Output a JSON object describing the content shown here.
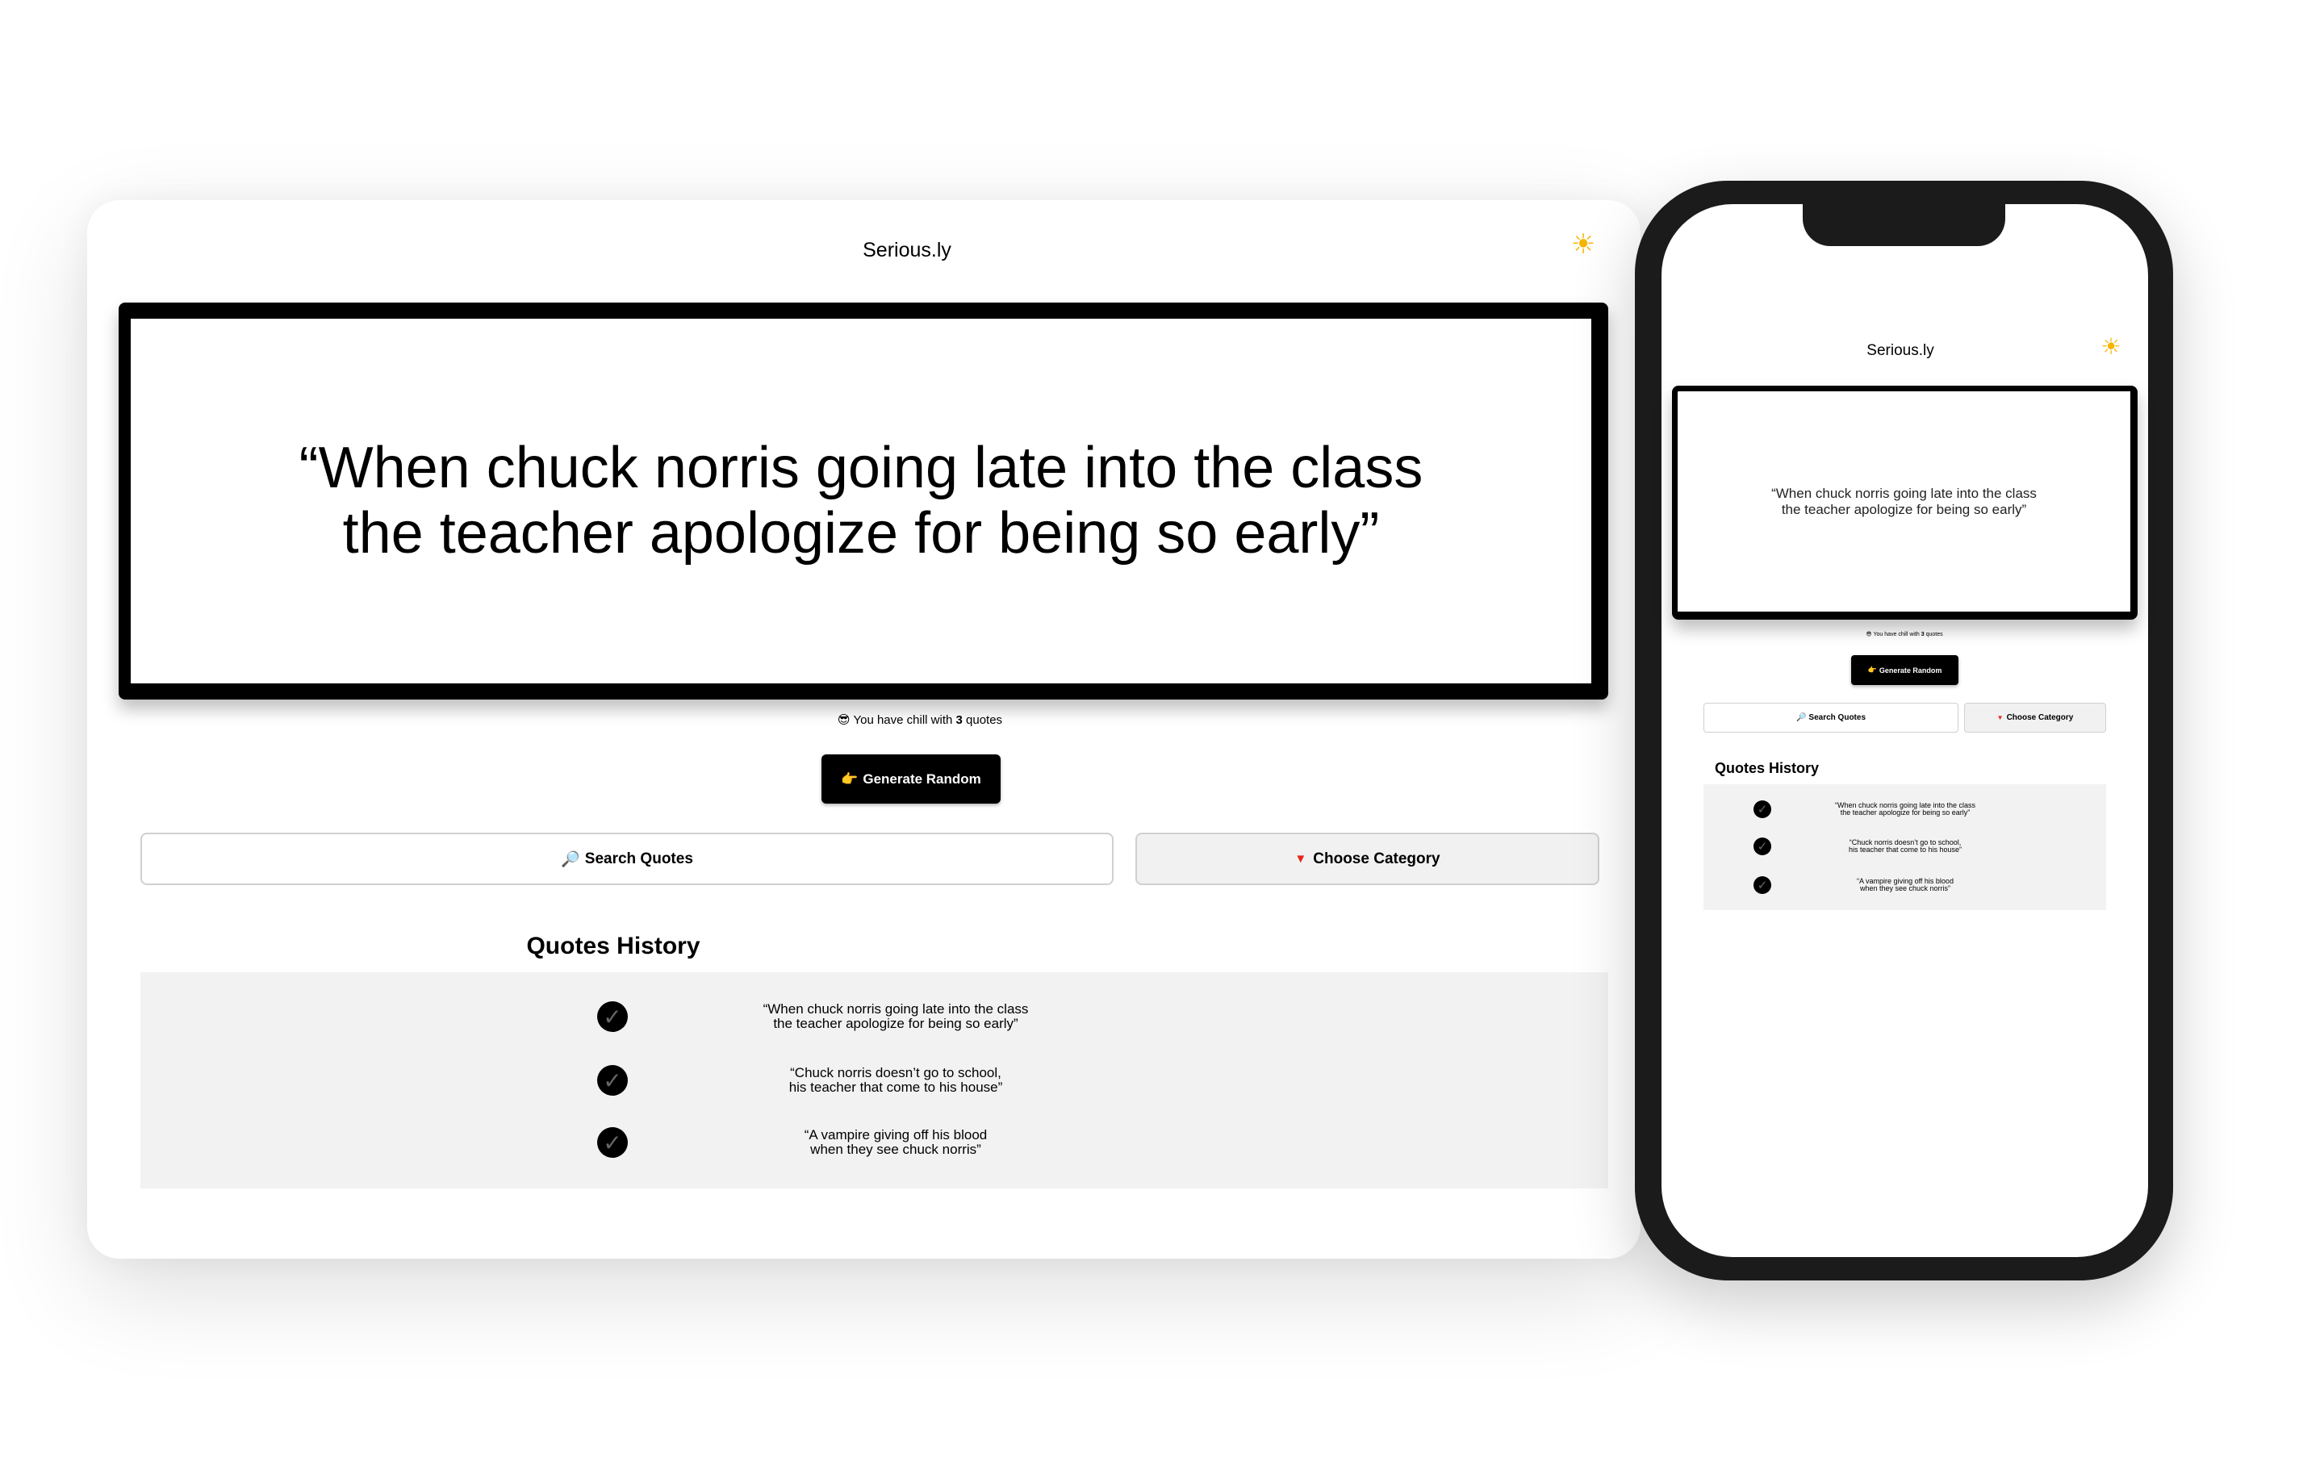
{
  "app": {
    "title": "Serious.ly",
    "theme_icon": "sun-icon"
  },
  "quote": {
    "text": "“When chuck norris going late into the class\nthe teacher apologize for being so early”"
  },
  "counter": {
    "prefix": "You have chill with",
    "count": "3",
    "suffix": "quotes",
    "icon": "sunglasses-emoji-icon"
  },
  "buttons": {
    "generate": "Generate Random",
    "search": "Search Quotes",
    "category": "Choose Category"
  },
  "history": {
    "title": "Quotes History",
    "items": [
      "“When chuck norris going late into the class\nthe teacher apologize for being so early”",
      "“Chuck norris doesn’t go to school,\nhis teacher that come to his house”",
      "“A vampire giving off his blood\nwhen they see chuck norris”"
    ]
  },
  "colors": {
    "accent": "#000000",
    "sun": "#f5b400",
    "panel": "#f2f2f2",
    "category_icon": "#e8231a"
  }
}
